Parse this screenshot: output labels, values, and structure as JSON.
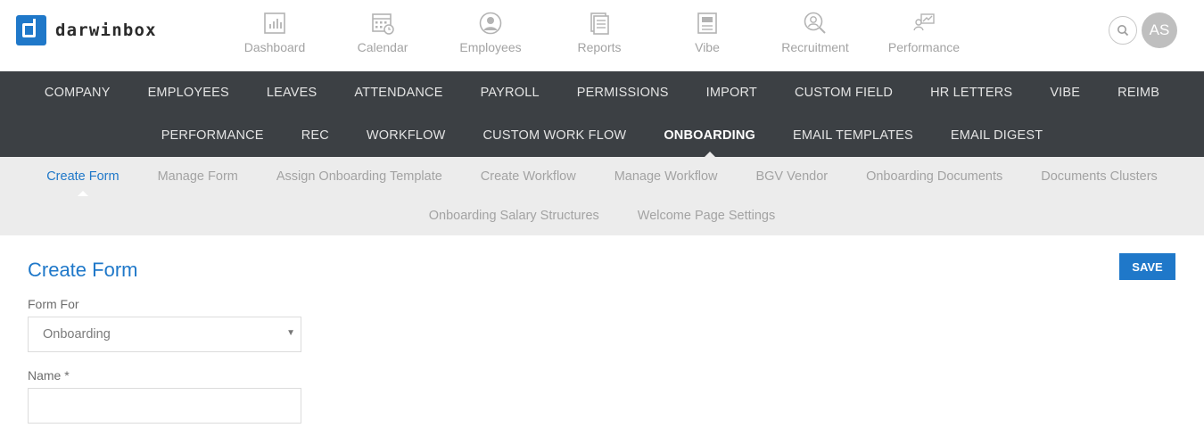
{
  "brand": {
    "name": "darwinbox"
  },
  "modules": [
    {
      "label": "Dashboard",
      "icon": "dashboard-icon"
    },
    {
      "label": "Calendar",
      "icon": "calendar-icon"
    },
    {
      "label": "Employees",
      "icon": "employees-icon"
    },
    {
      "label": "Reports",
      "icon": "reports-icon"
    },
    {
      "label": "Vibe",
      "icon": "vibe-icon"
    },
    {
      "label": "Recruitment",
      "icon": "recruitment-icon"
    },
    {
      "label": "Performance",
      "icon": "performance-icon"
    }
  ],
  "user": {
    "initials": "AS"
  },
  "admin_nav": {
    "row1": [
      "COMPANY",
      "EMPLOYEES",
      "LEAVES",
      "ATTENDANCE",
      "PAYROLL",
      "PERMISSIONS",
      "IMPORT",
      "CUSTOM FIELD",
      "HR LETTERS",
      "VIBE",
      "REIMB"
    ],
    "row2": [
      "PERFORMANCE",
      "REC",
      "WORKFLOW",
      "CUSTOM WORK FLOW",
      "ONBOARDING",
      "EMAIL TEMPLATES",
      "EMAIL DIGEST"
    ],
    "active": "ONBOARDING"
  },
  "sub_nav": {
    "row1": [
      "Create Form",
      "Manage Form",
      "Assign Onboarding Template",
      "Create Workflow",
      "Manage Workflow",
      "BGV Vendor",
      "Onboarding Documents",
      "Documents Clusters"
    ],
    "row2": [
      "Onboarding Salary Structures",
      "Welcome Page Settings"
    ],
    "active": "Create Form"
  },
  "form": {
    "title": "Create Form",
    "save_label": "SAVE",
    "form_for_label": "Form For",
    "form_for_value": "Onboarding",
    "name_label": "Name *",
    "name_value": ""
  },
  "colors": {
    "accent": "#1f78c9",
    "nav_dark": "#3c4044",
    "subnav_bg": "#ececec"
  }
}
